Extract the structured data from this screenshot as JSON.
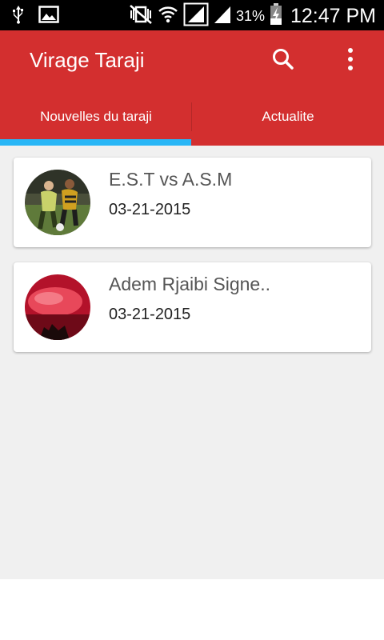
{
  "status_bar": {
    "battery_percent": "31%",
    "time": "12:47 PM",
    "icons": [
      "usb-icon",
      "image-icon",
      "mute-vibrate-icon",
      "wifi-icon",
      "signal-icon",
      "signal-icon-2",
      "battery-charging-icon"
    ]
  },
  "app_bar": {
    "title": "Virage Taraji",
    "actions": [
      "search-icon",
      "more-vert-icon"
    ],
    "color": "#d32f2f"
  },
  "tabs": [
    {
      "label": "Nouvelles du taraji",
      "selected": true
    },
    {
      "label": "Actualite",
      "selected": false
    }
  ],
  "tab_indicator_color": "#29b6f6",
  "news": [
    {
      "title": "E.S.T vs A.S.M",
      "date": "03-21-2015",
      "thumbnail": "football-match-photo"
    },
    {
      "title": "Adem Rjaibi Signe..",
      "date": "03-21-2015",
      "thumbnail": "red-crowd-flares-photo"
    }
  ]
}
